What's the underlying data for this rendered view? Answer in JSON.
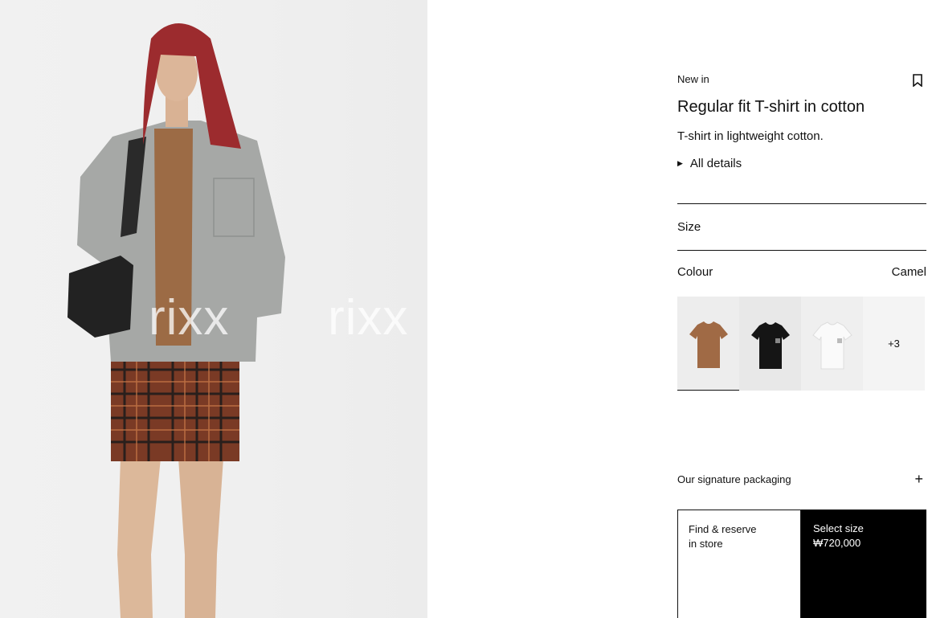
{
  "product": {
    "badge": "New in",
    "title": "Regular fit T-shirt in cotton",
    "description": "T-shirt in lightweight cotton.",
    "details_label": "All details"
  },
  "size": {
    "label": "Size"
  },
  "colour": {
    "label": "Colour",
    "selected": "Camel",
    "swatches": [
      {
        "name": "Camel",
        "color": "#a06a45"
      },
      {
        "name": "Black",
        "color": "#151515"
      },
      {
        "name": "White",
        "color": "#f4f4f4"
      }
    ],
    "more_label": "+3"
  },
  "packaging": {
    "label": "Our signature packaging"
  },
  "cta": {
    "reserve_line1": "Find & reserve",
    "reserve_line2": "in store",
    "select_label": "Select size",
    "price": "₩720,000"
  },
  "watermark": "rixx",
  "colors": {
    "accent": "#000000",
    "background": "#ffffff"
  }
}
